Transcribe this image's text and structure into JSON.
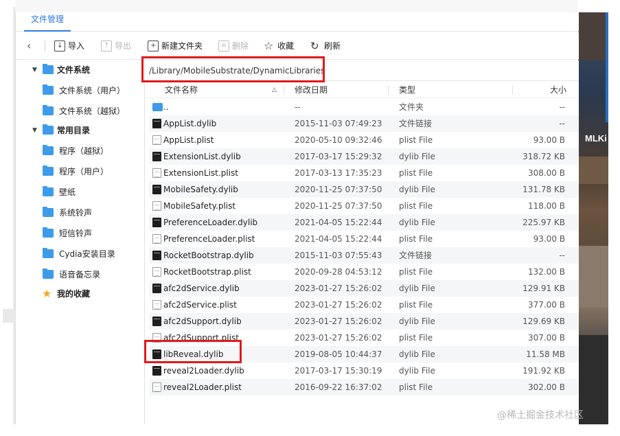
{
  "window": {
    "tab_label": "文件管理"
  },
  "toolbar": {
    "back_icon": "chevron-left-icon",
    "import_label": "导入",
    "export_label": "导出",
    "new_folder_label": "新建文件夹",
    "delete_label": "删除",
    "favorite_label": "收藏",
    "refresh_label": "刷新"
  },
  "sidebar": {
    "items": [
      {
        "label": "文件系统",
        "kind": "header"
      },
      {
        "label": "文件系统（用户）",
        "kind": "child"
      },
      {
        "label": "文件系统（越狱）",
        "kind": "child"
      },
      {
        "label": "常用目录",
        "kind": "header"
      },
      {
        "label": "程序（越狱）",
        "kind": "child"
      },
      {
        "label": "程序（用户）",
        "kind": "child"
      },
      {
        "label": "壁纸",
        "kind": "child"
      },
      {
        "label": "系统铃声",
        "kind": "child"
      },
      {
        "label": "短信铃声",
        "kind": "child"
      },
      {
        "label": "Cydia安装目录",
        "kind": "child"
      },
      {
        "label": "语音备忘录",
        "kind": "child"
      },
      {
        "label": "我的收藏",
        "kind": "favorite"
      }
    ]
  },
  "path": "/Library/MobileSubstrate/DynamicLibraries",
  "table": {
    "columns": {
      "name": "文件名称",
      "date": "修改日期",
      "type": "类型",
      "size": "大小"
    },
    "rows": [
      {
        "icon": "folder",
        "name": "..",
        "date": "--",
        "type": "文件夹",
        "size": "--"
      },
      {
        "icon": "dylib",
        "name": "AppList.dylib",
        "date": "2015-11-03 07:49:23",
        "type": "文件链接",
        "size": "--"
      },
      {
        "icon": "plist",
        "name": "AppList.plist",
        "date": "2020-05-10 09:32:46",
        "type": "plist File",
        "size": "93.00 B"
      },
      {
        "icon": "dylib",
        "name": "ExtensionList.dylib",
        "date": "2017-03-17 15:29:32",
        "type": "dylib File",
        "size": "318.72 KB"
      },
      {
        "icon": "plist",
        "name": "ExtensionList.plist",
        "date": "2017-03-13 17:35:23",
        "type": "plist File",
        "size": "308.00 B"
      },
      {
        "icon": "dylib",
        "name": "MobileSafety.dylib",
        "date": "2020-11-25 07:37:50",
        "type": "dylib File",
        "size": "131.78 KB"
      },
      {
        "icon": "plist",
        "name": "MobileSafety.plist",
        "date": "2020-11-25 07:37:50",
        "type": "plist File",
        "size": "118.00 B"
      },
      {
        "icon": "dylib",
        "name": "PreferenceLoader.dylib",
        "date": "2021-04-05 15:22:44",
        "type": "dylib File",
        "size": "225.97 KB"
      },
      {
        "icon": "plist",
        "name": "PreferenceLoader.plist",
        "date": "2021-04-05 15:22:44",
        "type": "plist File",
        "size": "93.00 B"
      },
      {
        "icon": "dylib",
        "name": "RocketBootstrap.dylib",
        "date": "2015-11-03 07:55:43",
        "type": "文件链接",
        "size": "--"
      },
      {
        "icon": "plist",
        "name": "RocketBootstrap.plist",
        "date": "2020-09-28 04:53:12",
        "type": "plist File",
        "size": "132.00 B"
      },
      {
        "icon": "dylib",
        "name": "afc2dService.dylib",
        "date": "2023-01-27 15:26:02",
        "type": "dylib File",
        "size": "129.91 KB"
      },
      {
        "icon": "plist",
        "name": "afc2dService.plist",
        "date": "2023-01-27 15:26:02",
        "type": "plist File",
        "size": "377.00 B"
      },
      {
        "icon": "dylib",
        "name": "afc2dSupport.dylib",
        "date": "2023-01-27 15:26:02",
        "type": "dylib File",
        "size": "129.69 KB"
      },
      {
        "icon": "plist",
        "name": "afc2dSupport.plist",
        "date": "2023-01-27 15:26:02",
        "type": "plist File",
        "size": "307.00 B"
      },
      {
        "icon": "dylib",
        "name": "libReveal.dylib",
        "date": "2019-08-05 10:44:37",
        "type": "dylib File",
        "size": "11.58 MB"
      },
      {
        "icon": "dylib",
        "name": "reveal2Loader.dylib",
        "date": "2017-03-17 15:30:19",
        "type": "dylib File",
        "size": "191.92 KB"
      },
      {
        "icon": "plist",
        "name": "reveal2Loader.plist",
        "date": "2016-09-22 16:37:02",
        "type": "plist File",
        "size": "302.00 B"
      }
    ]
  },
  "background": {
    "right_label": "MLKi"
  },
  "watermark": "@稀土掘金技术社区",
  "colors": {
    "accent": "#2c7be5",
    "folder": "#3d9be9",
    "highlight_box": "#e0191d",
    "favorite_star": "#f5a623"
  }
}
